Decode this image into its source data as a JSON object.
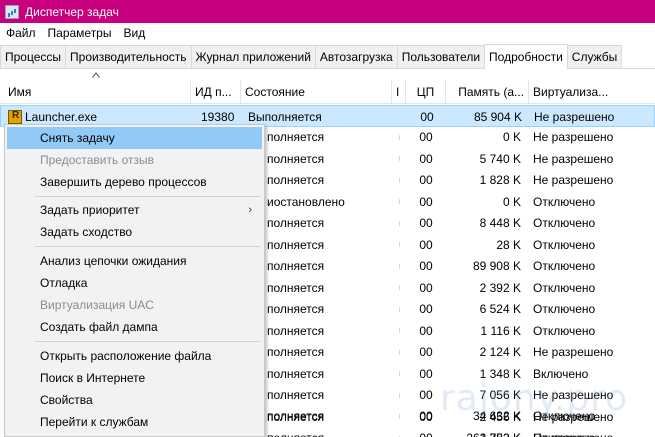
{
  "window": {
    "title": "Диспетчер задач"
  },
  "menubar": {
    "items": [
      "Файл",
      "Параметры",
      "Вид"
    ]
  },
  "tabs": [
    "Процессы",
    "Производительность",
    "Журнал приложений",
    "Автозагрузка",
    "Пользователи",
    "Подробности",
    "Службы"
  ],
  "active_tab": "Подробности",
  "columns": [
    "Имя",
    "ИД п...",
    "Состояние",
    "І",
    "ЦП",
    "Память (а...",
    "Виртуализа..."
  ],
  "rows": [
    {
      "name": "Launcher.exe",
      "pid": "19380",
      "state": "Выполняется",
      "cpu": "00",
      "mem": "85 904 K",
      "virt": "Не разрешено"
    },
    {
      "name": "",
      "pid": "",
      "state": "полняется",
      "cpu": "00",
      "mem": "0 K",
      "virt": "Не разрешено"
    },
    {
      "name": "",
      "pid": "",
      "state": "полняется",
      "cpu": "00",
      "mem": "5 740 K",
      "virt": "Не разрешено"
    },
    {
      "name": "",
      "pid": "",
      "state": "полняется",
      "cpu": "00",
      "mem": "1 828 K",
      "virt": "Не разрешено"
    },
    {
      "name": "",
      "pid": "",
      "state": "иостановлено",
      "cpu": "00",
      "mem": "0 K",
      "virt": "Отключено"
    },
    {
      "name": "",
      "pid": "",
      "state": "полняется",
      "cpu": "00",
      "mem": "8 448 K",
      "virt": "Отключено"
    },
    {
      "name": "",
      "pid": "",
      "state": "полняется",
      "cpu": "00",
      "mem": "28 K",
      "virt": "Отключено"
    },
    {
      "name": "",
      "pid": "",
      "state": "полняется",
      "cpu": "00",
      "mem": "89 908 K",
      "virt": "Отключено"
    },
    {
      "name": "",
      "pid": "",
      "state": "полняется",
      "cpu": "00",
      "mem": "2 392 K",
      "virt": "Отключено"
    },
    {
      "name": "",
      "pid": "",
      "state": "полняется",
      "cpu": "00",
      "mem": "6 524 K",
      "virt": "Отключено"
    },
    {
      "name": "",
      "pid": "",
      "state": "полняется",
      "cpu": "00",
      "mem": "1 116 K",
      "virt": "Отключено"
    },
    {
      "name": "",
      "pid": "",
      "state": "полняется",
      "cpu": "00",
      "mem": "2 124 K",
      "virt": "Не разрешено"
    },
    {
      "name": "",
      "pid": "",
      "state": "полняется",
      "cpu": "00",
      "mem": "1 348 K",
      "virt": "Включено"
    },
    {
      "name": "",
      "pid": "",
      "state": "полняется",
      "cpu": "00",
      "mem": "7 056 K",
      "virt": "Не разрешено"
    },
    {
      "name": "",
      "pid": "",
      "state": "полняется",
      "cpu": "00",
      "mem": "2 456 K",
      "virt": "Не разрешено"
    },
    {
      "name": "",
      "pid": "",
      "state": "полняется",
      "cpu": "00",
      "mem": "2 392 K",
      "virt": "Отключено"
    },
    {
      "name": "",
      "pid": "",
      "state": "полняется",
      "cpu": "00",
      "mem": "34 632 K",
      "virt": "Отключено"
    },
    {
      "name": "",
      "pid": "",
      "state": "",
      "cpu": "",
      "mem": "261 752 K",
      "virt": "Не разрешено"
    }
  ],
  "context_menu": {
    "items": [
      {
        "label": "Снять задачу",
        "state": "highlighted"
      },
      {
        "label": "Предоставить отзыв",
        "state": "disabled"
      },
      {
        "label": "Завершить дерево процессов",
        "state": "normal"
      },
      {
        "label": "Задать приоритет",
        "state": "submenu"
      },
      {
        "label": "Задать сходство",
        "state": "normal"
      },
      {
        "label": "Анализ цепочки ожидания",
        "state": "normal"
      },
      {
        "label": "Отладка",
        "state": "normal"
      },
      {
        "label": "Виртуализация UAC",
        "state": "disabled"
      },
      {
        "label": "Создать файл дампа",
        "state": "normal"
      },
      {
        "label": "Открыть расположение файла",
        "state": "normal"
      },
      {
        "label": "Поиск в Интернете",
        "state": "normal"
      },
      {
        "label": "Свойства",
        "state": "normal"
      },
      {
        "label": "Перейти к службам",
        "state": "normal"
      }
    ]
  },
  "watermark": "rajony.pro",
  "colors": {
    "title_bar": "#c8007e",
    "selection": "#cce8ff",
    "menu_highlight": "#91c9f7"
  }
}
